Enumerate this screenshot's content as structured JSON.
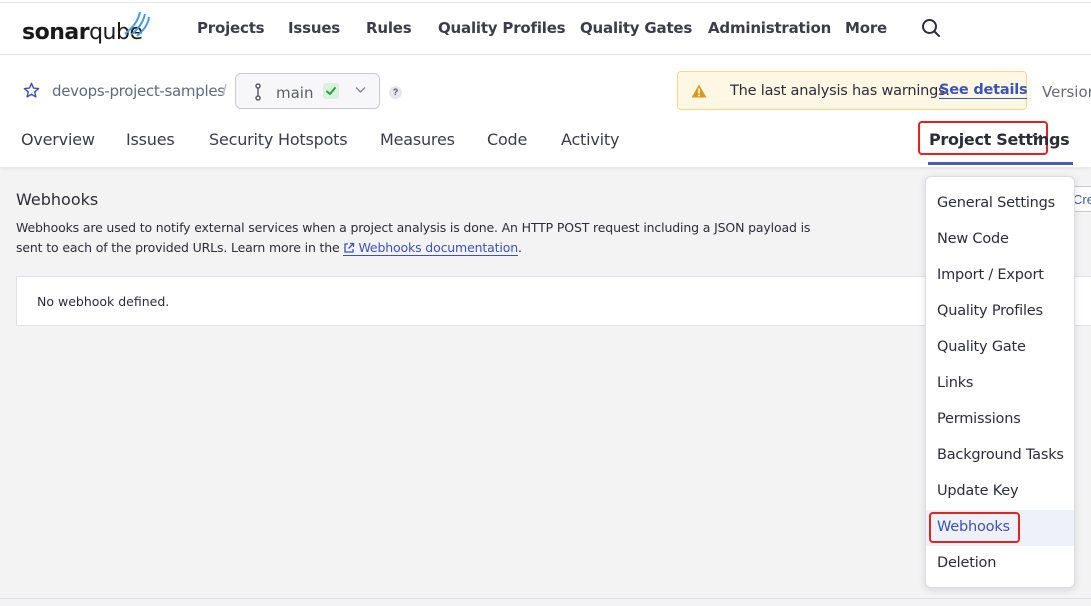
{
  "brand": {
    "sonar": "sonar",
    "qube": "qube"
  },
  "topnav": [
    "Projects",
    "Issues",
    "Rules",
    "Quality Profiles",
    "Quality Gates",
    "Administration",
    "More"
  ],
  "project": {
    "name": "devops-project-samples",
    "separator": "/",
    "branch": "main",
    "help": "?",
    "warning_text": "The last analysis has warnings.",
    "warning_link": "See details",
    "version_label": "Version"
  },
  "tabs": [
    "Overview",
    "Issues",
    "Security Hotspots",
    "Measures",
    "Code",
    "Activity"
  ],
  "settings_tab": "Project Settings",
  "main": {
    "title": "Webhooks",
    "description_1": "Webhooks are used to notify external services when a project analysis is done. An HTTP POST request including a JSON payload is sent to each of the provided URLs. Learn more in the",
    "doc_link": "Webhooks documentation",
    "description_end": ".",
    "create_button": "Create",
    "empty_text": "No webhook defined."
  },
  "dropdown": {
    "items": [
      "General Settings",
      "New Code",
      "Import / Export",
      "Quality Profiles",
      "Quality Gate",
      "Links",
      "Permissions",
      "Background Tasks",
      "Update Key",
      "Webhooks",
      "Deletion"
    ],
    "active": "Webhooks"
  },
  "colors": {
    "accent": "#3c53b7",
    "highlight_border": "#e02424",
    "warning_bg": "#fdf7e4",
    "success": "#2e9e45"
  }
}
